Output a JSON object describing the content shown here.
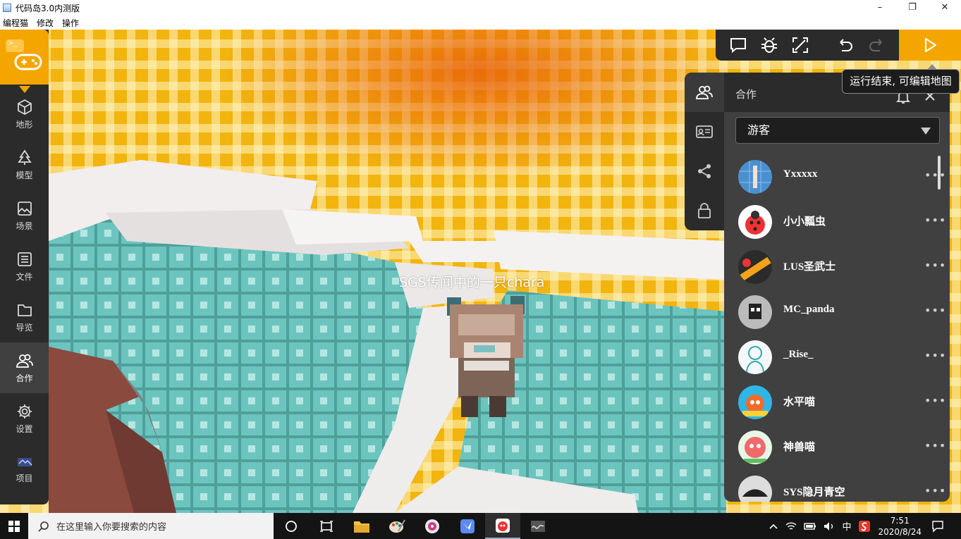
{
  "window": {
    "title": "代码岛3.0内测版",
    "minimize_glyph": "–",
    "maximize_glyph": "❐",
    "close_glyph": "✕"
  },
  "menu": [
    "编程猫",
    "修改",
    "操作"
  ],
  "sidebar": {
    "items": [
      {
        "label": "地形",
        "icon": "cube-icon"
      },
      {
        "label": "模型",
        "icon": "tree-icon"
      },
      {
        "label": "场景",
        "icon": "image-icon"
      },
      {
        "label": "文件",
        "icon": "file-list-icon"
      },
      {
        "label": "导览",
        "icon": "folder-icon"
      },
      {
        "label": "合作",
        "icon": "users-icon",
        "active": true
      },
      {
        "label": "设置",
        "icon": "gear-icon"
      },
      {
        "label": "项目",
        "icon": "project-icon"
      }
    ]
  },
  "toolbar": {
    "buttons": [
      "comment-icon",
      "bug-icon",
      "fullscreen-icon",
      "undo-icon",
      "redo-icon"
    ],
    "run": "play-icon"
  },
  "tooltip": "运行结束, 可编辑地图",
  "scene": {
    "player_name": "SGS传闻中的一只chara"
  },
  "collab": {
    "title": "合作",
    "dropdown_value": "游客",
    "users": [
      {
        "name": "Yxxxxx"
      },
      {
        "name": "小小瓢虫"
      },
      {
        "name": "LUS圣武士"
      },
      {
        "name": "MC_panda"
      },
      {
        "name": "_Rise_"
      },
      {
        "name": "水平喵"
      },
      {
        "name": "神兽喵"
      },
      {
        "name": "SYS隐月青空"
      }
    ],
    "more_glyph": "•••"
  },
  "taskbar": {
    "search_placeholder": "在这里输入你要搜索的内容",
    "ime": "中",
    "time": "7:51",
    "date": "2020/8/24"
  },
  "colors": {
    "accent": "#f5a500",
    "panel": "#2b2b2b",
    "panel_body": "#404040"
  }
}
